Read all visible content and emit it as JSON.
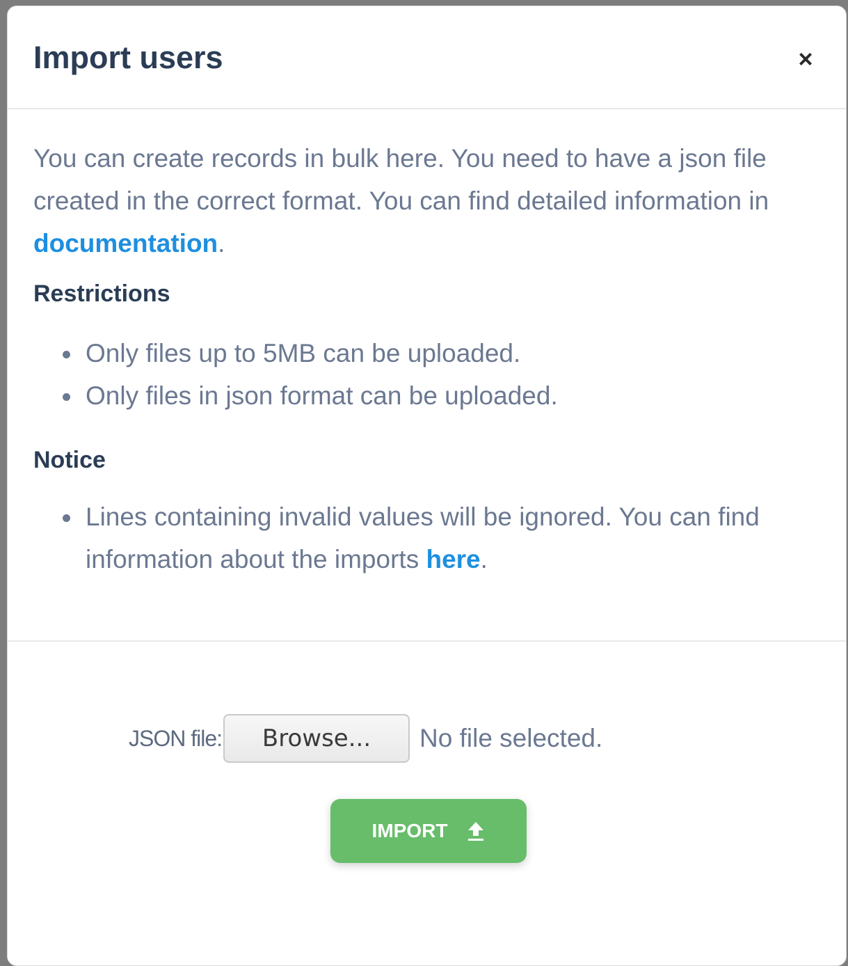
{
  "modal": {
    "title": "Import users",
    "close_symbol": "×"
  },
  "body": {
    "intro_text": "You can create records in bulk here. You need to have a json file created in the correct format. You can find detailed information in ",
    "intro_link": "documentation",
    "intro_end": ".",
    "restrictions": {
      "title": "Restrictions",
      "items": [
        "Only files up to 5MB can be uploaded.",
        "Only files in json format can be uploaded."
      ]
    },
    "notice": {
      "title": "Notice",
      "item_text": "Lines containing invalid values will be ignored. You can find information about the imports ",
      "item_link": "here",
      "item_end": "."
    }
  },
  "footer": {
    "file_label": "JSON file:",
    "browse_label": "Browse...",
    "file_status": "No file selected.",
    "import_label": "IMPORT",
    "import_icon": "upload-icon"
  },
  "colors": {
    "title": "#2b3d55",
    "body_text": "#6b7891",
    "link": "#1e8fe0",
    "import_button": "#67bd6a"
  }
}
